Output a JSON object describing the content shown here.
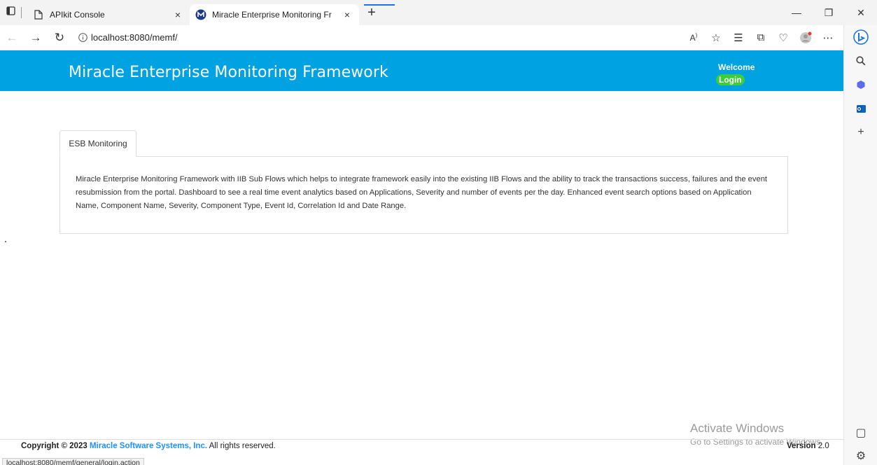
{
  "browser": {
    "tabs": [
      {
        "title": "APIkit Console",
        "active": false,
        "close": "×"
      },
      {
        "title": "Miracle Enterprise Monitoring Fr",
        "active": true,
        "close": "×"
      }
    ],
    "new_tab": "+",
    "window_controls": {
      "minimize": "—",
      "restore": "❐",
      "close": "✕"
    },
    "address": "localhost:8080/memf/",
    "status_url": "localhost:8080/memf/general/login.action"
  },
  "header": {
    "title": "Miracle Enterprise Monitoring Framework",
    "welcome": "Welcome",
    "login": "Login",
    "background": "#00a2e1"
  },
  "content": {
    "tab_label": "ESB Monitoring",
    "description": "Miracle Enterprise Monitoring Framework with IIB Sub Flows which helps to integrate framework easily into the existing IIB Flows and the ability to track the transactions success, failures and the event resubmission from the portal. Dashboard to see a real time event analytics based on Applications, Severity and number of events per the day. Enhanced event search options based on Application Name, Component Name, Severity, Component Type, Event Id, Correlation Id and Date Range."
  },
  "footer": {
    "copyright_prefix": "Copyright © 2023",
    "company": "Miracle Software Systems, Inc.",
    "rights": "All rights reserved.",
    "version_label": "Version",
    "version_value": "2.0"
  },
  "watermark": {
    "line1": "Activate Windows",
    "line2": "Go to Settings to activate Windows."
  }
}
